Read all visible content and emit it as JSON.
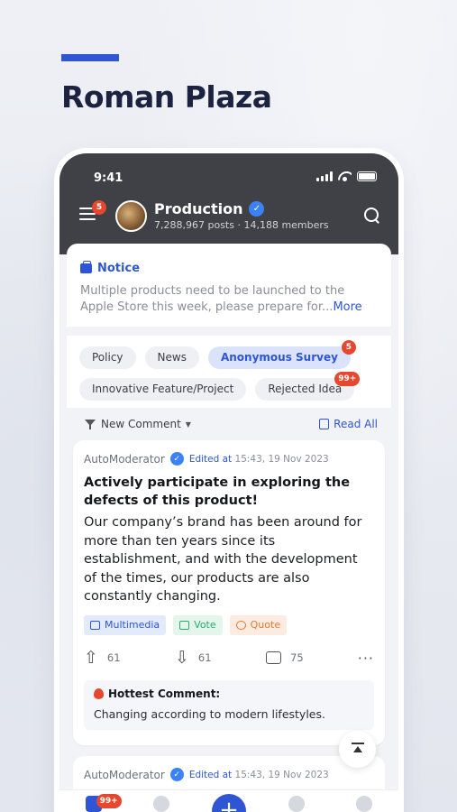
{
  "brand": {
    "title": "Roman Plaza",
    "accent": "#2f55d4"
  },
  "status_bar": {
    "time": "9:41"
  },
  "header": {
    "menu_badge": "5",
    "channel_name": "Production",
    "channel_stats": "7,288,967 posts · 14,188 members"
  },
  "notice": {
    "title": "Notice",
    "text": "Multiple products need to be launched to the Apple Store this week, please prepare for...",
    "more_label": "More"
  },
  "tags": [
    {
      "label": "Policy"
    },
    {
      "label": "News"
    },
    {
      "label": "Anonymous Survey",
      "badge": "5",
      "active": true
    },
    {
      "label": "Innovative Feature/Project"
    },
    {
      "label": "Rejected Idea",
      "badge": "99+"
    }
  ],
  "list_bar": {
    "sort_label": "New Comment",
    "read_all_label": "Read All"
  },
  "post": {
    "author": "AutoModerator",
    "edited_label": "Edited at",
    "edited_time": "15:43, 19 Nov 2023",
    "title": "Actively participate in exploring the defects of this product!",
    "body": "Our company’s brand has been around for more than ten years since its establishment, and with the development of the times, our products are also constantly changing.",
    "chips": [
      "Multimedia",
      "Vote",
      "Quote"
    ],
    "upvotes": "61",
    "downvotes": "61",
    "comments": "75",
    "more_icon": "more-dots-icon",
    "hottest_label": "Hottest Comment:",
    "hottest_text": "Changing according to modern lifestyles."
  },
  "post2": {
    "author": "AutoModerator",
    "edited_label": "Edited at",
    "edited_time": "15:43, 19 Nov 2023"
  },
  "tabbar": {
    "first_badge": "99+",
    "fab_label": "+"
  },
  "colors": {
    "header_bg": "#404147",
    "badge": "#e5472f",
    "link": "#2f55d4"
  }
}
